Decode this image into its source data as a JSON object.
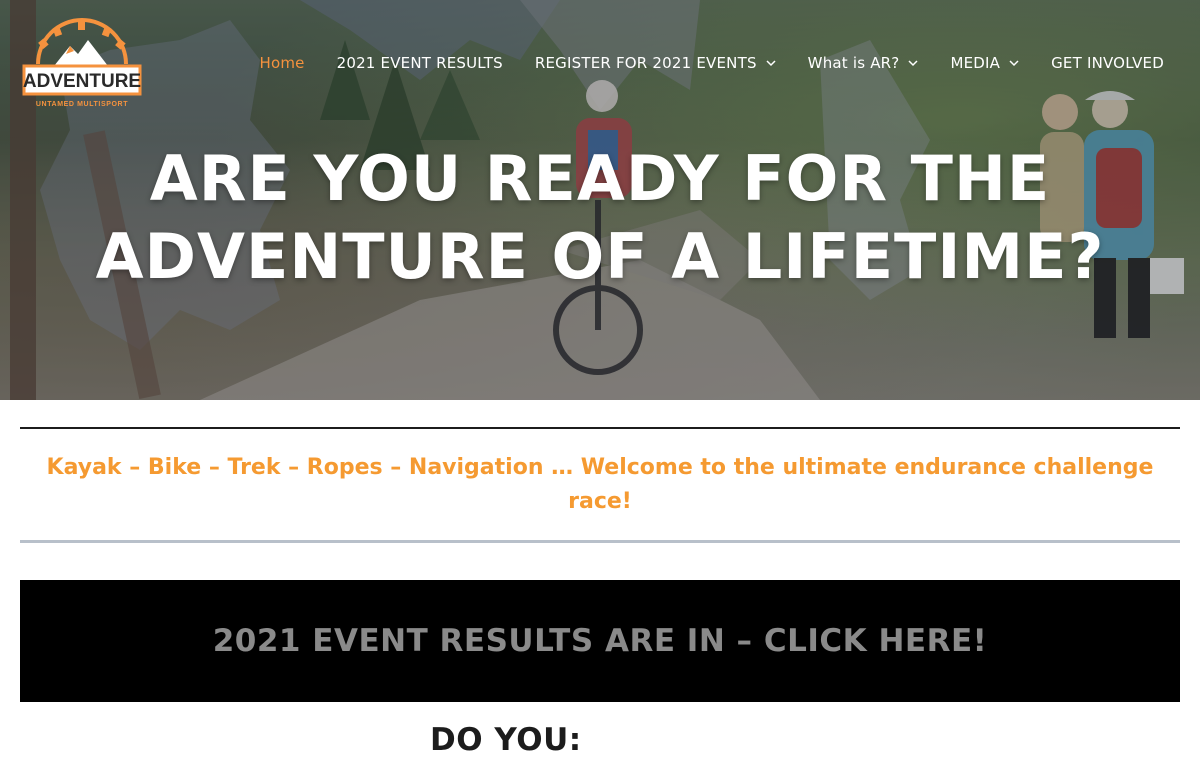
{
  "brand": {
    "logo_top_text": "ALL OUT",
    "logo_main_text": "ADVENTURE",
    "logo_sub_text": "UNTAMED MULTISPORT",
    "logo_color": "#f5923e"
  },
  "nav": {
    "items": [
      {
        "label": "Home",
        "active": true,
        "dropdown": false
      },
      {
        "label": "2021 EVENT RESULTS",
        "active": false,
        "dropdown": false
      },
      {
        "label": "REGISTER FOR 2021 EVENTS",
        "active": false,
        "dropdown": true
      },
      {
        "label": "What is AR?",
        "active": false,
        "dropdown": true
      },
      {
        "label": "MEDIA",
        "active": false,
        "dropdown": true
      },
      {
        "label": "GET INVOLVED",
        "active": false,
        "dropdown": false
      }
    ],
    "active_color": "#f5923e",
    "dropdown_icon": "chevron-down-icon"
  },
  "hero": {
    "title_line1": "ARE YOU READY FOR THE",
    "title_line2": "ADVENTURE OF A LIFETIME?"
  },
  "tagline": {
    "text": "Kayak – Bike – Trek – Ropes – Navigation … Welcome to the ultimate endurance challenge race!",
    "color": "#f59a31"
  },
  "results_banner": {
    "text": "2021 EVENT RESULTS ARE IN – CLICK HERE!"
  },
  "section": {
    "heading": "DO YOU:"
  }
}
